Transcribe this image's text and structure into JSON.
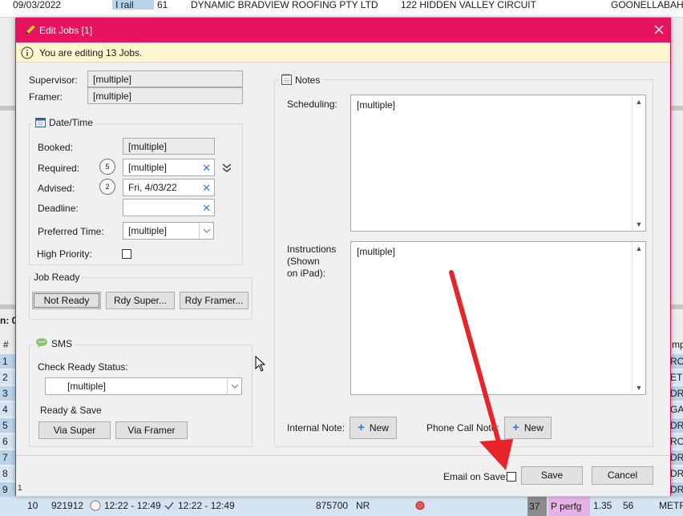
{
  "background": {
    "top_row": {
      "date": "09/03/2022",
      "col2": "I rail",
      "col3": "61",
      "company": "DYNAMIC BRADVIEW ROOFING PTY LTD",
      "address": "122 HIDDEN VALLEY CIRCUIT",
      "suburb": "GOONELLABAH"
    },
    "left_label": "n: 0",
    "hash_header": "#",
    "right_header": "mp",
    "row_numbers": [
      "1",
      "2",
      "3",
      "4",
      "5",
      "6",
      "7",
      "8",
      "9"
    ],
    "right_fragments": [
      "RO",
      "ETR",
      "DRA",
      "GA",
      "DRA",
      "RO",
      "DRA",
      "DRA",
      "DRA"
    ],
    "bottom_row": {
      "num": "10",
      "id": "921912",
      "time1": "12:22 - 12:49",
      "time2": "12:22 - 12:49",
      "amount": "875700",
      "code": "NR",
      "val1": "37",
      "val2": "P perfg",
      "val3": "1.35",
      "val4": "56",
      "val5": "METR"
    }
  },
  "dialog": {
    "title": "Edit Jobs [1]",
    "info": "You are editing 13 Jobs.",
    "supervisor_label": "Supervisor:",
    "supervisor_value": "[multiple]",
    "framer_label": "Framer:",
    "framer_value": "[multiple]",
    "datetime": {
      "title": "Date/Time",
      "booked_label": "Booked:",
      "booked_value": "[multiple]",
      "required_label": "Required:",
      "required_badge": "5",
      "required_value": "[multiple]",
      "advised_label": "Advised:",
      "advised_badge": "2",
      "advised_value": "Fri, 4/03/22",
      "deadline_label": "Deadline:",
      "deadline_value": "",
      "preferred_label": "Preferred Time:",
      "preferred_value": "[multiple]",
      "priority_label": "High Priority:"
    },
    "job_ready": {
      "title": "Job Ready",
      "not_ready": "Not Ready",
      "rdy_super": "Rdy Super...",
      "rdy_framer": "Rdy Framer..."
    },
    "sms": {
      "title": "SMS",
      "check_label": "Check Ready Status:",
      "check_value": "[multiple]",
      "ready_save_label": "Ready & Save",
      "via_super": "Via Super",
      "via_framer": "Via Framer"
    },
    "notes": {
      "title": "Notes",
      "scheduling_label": "Scheduling:",
      "scheduling_value": "[multiple]",
      "instructions_label_1": "Instructions",
      "instructions_label_2": "(Shown",
      "instructions_label_3": "on iPad):",
      "instructions_value": "[multiple]",
      "internal_note_label": "Internal Note:",
      "phone_call_label": "Phone Call Note:",
      "new_label": "New"
    },
    "footer": {
      "corner": "1",
      "email_label": "Email on Save:",
      "save": "Save",
      "cancel": "Cancel"
    }
  },
  "colors": {
    "titlebar": "#e6135e",
    "infobar": "#fdf6cf",
    "annotation_arrow": "#e8242a",
    "plus_icon": "#3b7bd6"
  }
}
